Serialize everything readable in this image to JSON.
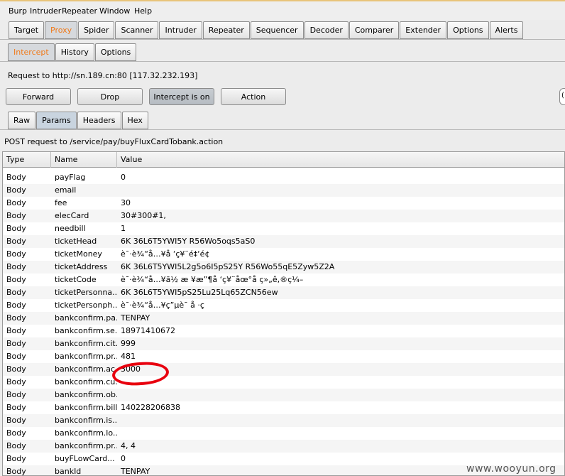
{
  "menubar": [
    "Burp",
    "Intruder",
    "Repeater",
    "Window",
    "Help"
  ],
  "main_tabs": [
    "Target",
    "Proxy",
    "Spider",
    "Scanner",
    "Intruder",
    "Repeater",
    "Sequencer",
    "Decoder",
    "Comparer",
    "Extender",
    "Options",
    "Alerts"
  ],
  "main_active": "Proxy",
  "proxy_tabs": [
    "Intercept",
    "History",
    "Options"
  ],
  "proxy_active": "Intercept",
  "request_line": "Request to http://sn.189.cn:80  [117.32.232.193]",
  "buttons": {
    "forward": "Forward",
    "drop": "Drop",
    "intercept": "Intercept is on",
    "action": "Action"
  },
  "search_stub": "(",
  "view_tabs": [
    "Raw",
    "Params",
    "Headers",
    "Hex"
  ],
  "view_active": "Params",
  "post_line": "POST request to /service/pay/buyFluxCardTobank.action",
  "table": {
    "headers": [
      "Type",
      "Name",
      "Value"
    ],
    "rows": [
      [
        "Body",
        "payFlag",
        "0"
      ],
      [
        "Body",
        "email",
        ""
      ],
      [
        "Body",
        "fee",
        "30"
      ],
      [
        "Body",
        "elecCard",
        "30#300#1,"
      ],
      [
        "Body",
        "needbill",
        "1"
      ],
      [
        "Body",
        "ticketHead",
        "6K 36L6T5YWI5Y R56Wo5oqs5aS0"
      ],
      [
        "Body",
        "ticketMoney",
        "è¯·è¾“å…¥å  ‘ç¥¨é‡‘é¢"
      ],
      [
        "Body",
        "ticketAddress",
        "6K 36L6T5YWI5L2g5o6I5pS25Y R56Wo55qE5Zyw5Z2A"
      ],
      [
        "Body",
        "ticketCode",
        "è¯·è¾“å…¥ä½ æ ¥æ”¶å  ‘ç¥¨åœ°å   ç»„ê‚®ç¼–"
      ],
      [
        "Body",
        "ticketPersonna...",
        "6K 36L6T5YWI5pS25Lu25Lq65ZCN56ew"
      ],
      [
        "Body",
        "ticketPersonph...",
        "è¯·è¾“å…¥ç”µè¯  å  ·ç"
      ],
      [
        "Body",
        "bankconfirm.pa...",
        "TENPAY"
      ],
      [
        "Body",
        "bankconfirm.se...",
        "18971410672"
      ],
      [
        "Body",
        "bankconfirm.cit...",
        "999"
      ],
      [
        "Body",
        "bankconfirm.pr...",
        "481"
      ],
      [
        "Body",
        "bankconfirm.ac...",
        "3000"
      ],
      [
        "Body",
        "bankconfirm.cu...",
        ""
      ],
      [
        "Body",
        "bankconfirm.ob...",
        ""
      ],
      [
        "Body",
        "bankconfirm.bill...",
        "140228206838"
      ],
      [
        "Body",
        "bankconfirm.is...",
        ""
      ],
      [
        "Body",
        "bankconfirm.lo...",
        ""
      ],
      [
        "Body",
        "bankconfirm.pr...",
        "4, 4"
      ],
      [
        "Body",
        "buyFLowCard...",
        "0"
      ],
      [
        "Body",
        "bankId",
        "TENPAY"
      ]
    ]
  },
  "watermark": "www.wooyun.org",
  "colors": {
    "active_tab_text": "#f07a1a",
    "annotation_red": "#e8000e"
  }
}
